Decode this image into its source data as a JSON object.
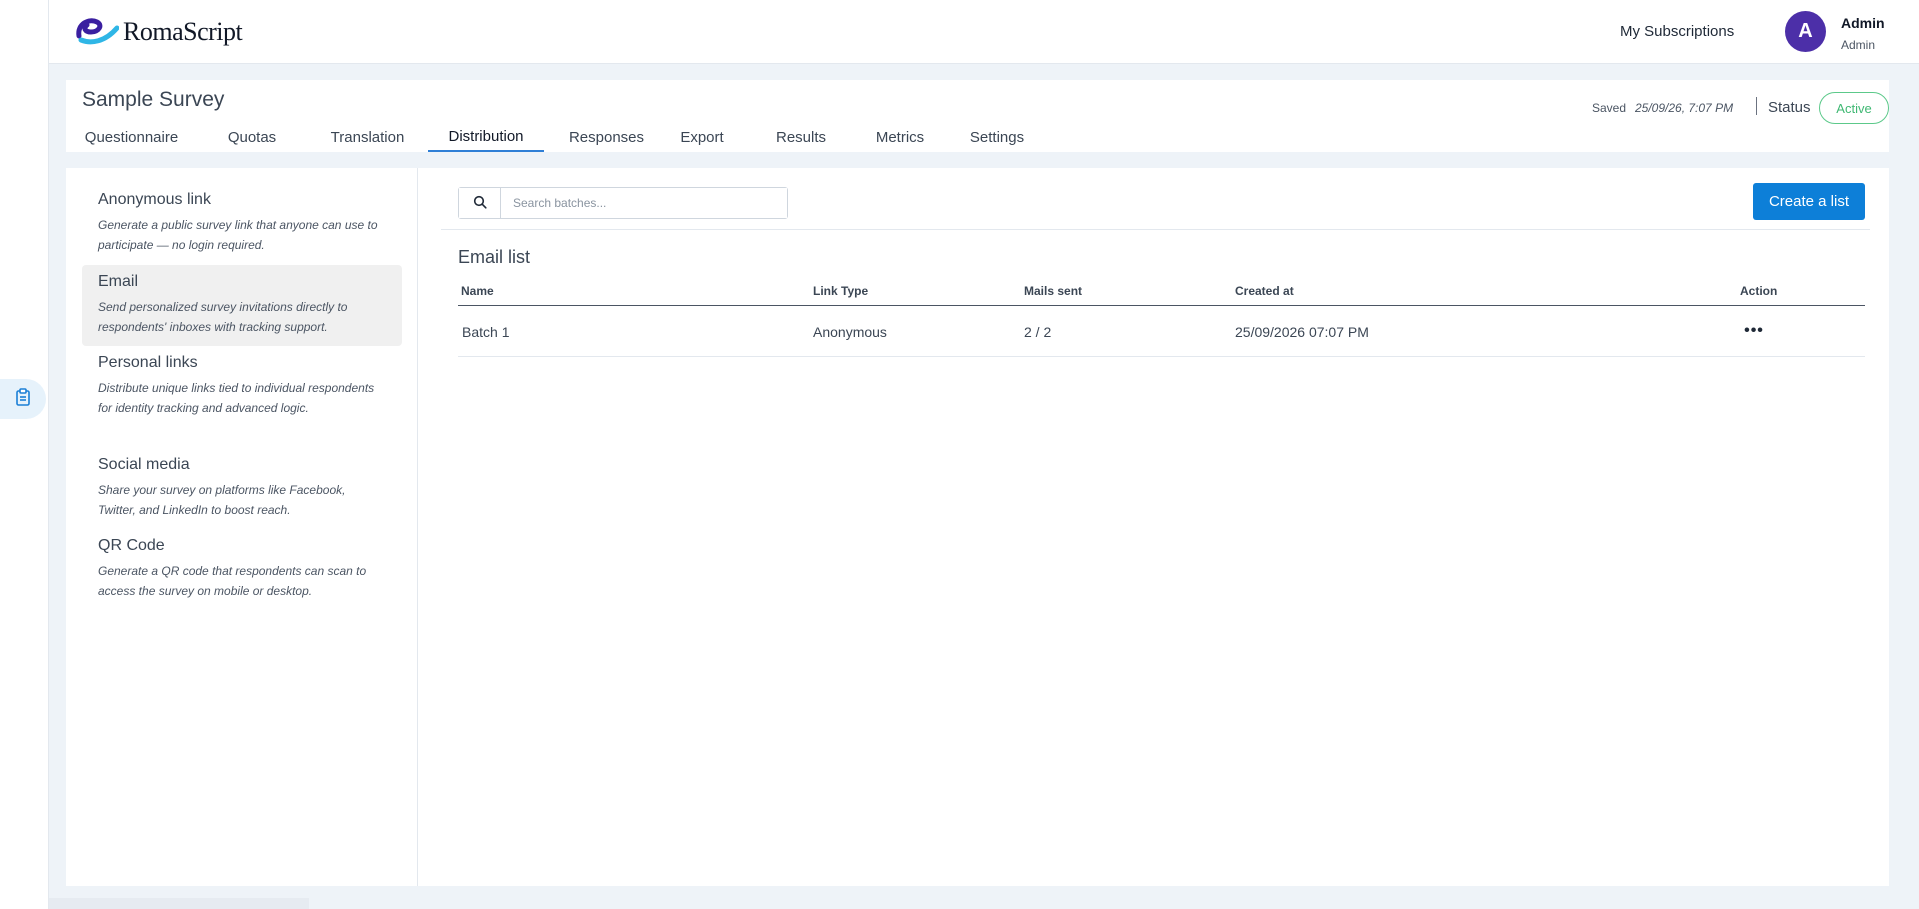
{
  "brand": {
    "name": "RomaScript"
  },
  "header": {
    "subscriptions_label": "My Subscriptions",
    "user": {
      "initial": "A",
      "name": "Admin",
      "role": "Admin"
    }
  },
  "survey": {
    "title": "Sample Survey",
    "saved_label": "Saved",
    "saved_time": "25/09/26, 7:07 PM",
    "status_label": "Status",
    "status_value": "Active",
    "tabs": [
      {
        "label": "Questionnaire"
      },
      {
        "label": "Quotas"
      },
      {
        "label": "Translation"
      },
      {
        "label": "Distribution",
        "active": true
      },
      {
        "label": "Responses"
      },
      {
        "label": "Export"
      },
      {
        "label": "Results"
      },
      {
        "label": "Metrics"
      },
      {
        "label": "Settings"
      }
    ]
  },
  "distribution": {
    "items": [
      {
        "title": "Anonymous link",
        "desc": "Generate a public survey link that anyone can use to participate — no login required."
      },
      {
        "title": "Email",
        "desc": "Send personalized survey invitations directly to respondents' inboxes with tracking support.",
        "active": true
      },
      {
        "title": "Personal links",
        "desc": "Distribute unique links tied to individual respondents for identity tracking and advanced logic."
      },
      {
        "title": "Social media",
        "desc": "Share your survey on platforms like Facebook, Twitter, and LinkedIn to boost reach."
      },
      {
        "title": "QR Code",
        "desc": "Generate a QR code that respondents can scan to access the survey on mobile or desktop."
      }
    ]
  },
  "email_list": {
    "search_placeholder": "Search batches...",
    "create_label": "Create a list",
    "title": "Email list",
    "columns": [
      "Name",
      "Link Type",
      "Mails sent",
      "Created at",
      "Action"
    ],
    "rows": [
      {
        "name": "Batch 1",
        "link_type": "Anonymous",
        "mails_sent": "2 / 2",
        "created_at": "25/09/2026 07:07 PM",
        "action": "•••"
      }
    ]
  },
  "colors": {
    "accent": "#0d7fd8",
    "avatar": "#4c2fa8",
    "status_active": "#3fb873",
    "tab_underline": "#2f7fd6"
  },
  "icons": {
    "rail": "clipboard-icon",
    "search": "search-icon",
    "action": "more-horizontal-icon"
  }
}
